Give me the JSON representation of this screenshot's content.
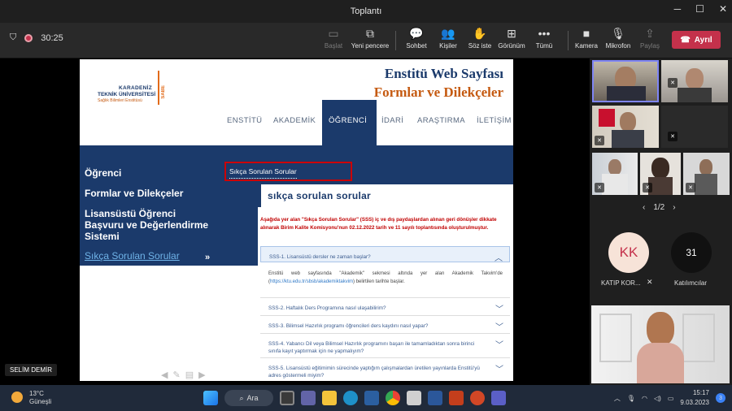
{
  "window": {
    "title": "Toplantı"
  },
  "toolbar": {
    "timer": "30:25",
    "buttons": [
      {
        "label": "Başlat",
        "icon": "start-icon"
      },
      {
        "label": "Yeni pencere",
        "icon": "popout-icon"
      },
      {
        "label": "Sohbet",
        "icon": "chat-icon"
      },
      {
        "label": "Kişiler",
        "icon": "people-icon"
      },
      {
        "label": "Söz iste",
        "icon": "raise-hand-icon"
      },
      {
        "label": "Görünüm",
        "icon": "view-icon"
      },
      {
        "label": "Tümü",
        "icon": "more-icon"
      },
      {
        "label": "Kamera",
        "icon": "camera-icon"
      },
      {
        "label": "Mikrofon",
        "icon": "mic-off-icon"
      },
      {
        "label": "Paylaş",
        "icon": "share-icon"
      }
    ],
    "leave_label": "Ayrıl"
  },
  "slide": {
    "logo": {
      "line1": "KARADENİZ",
      "line2": "TEKNİK ÜNİVERSİTESİ",
      "line3": "Sağlık Bilimleri Enstitüsü",
      "badge": "SABE"
    },
    "title1": "Enstitü Web Sayfası",
    "title2": "Formlar ve Dilekçeler",
    "nav": [
      "ENSTİTÜ",
      "AKADEMİK",
      "ÖĞRENCİ",
      "İDARİ",
      "ARAŞTIRMA",
      "İLETİŞİM"
    ],
    "sidemenu": [
      "Öğrenci",
      "Formlar ve Dilekçeler",
      "Lisansüstü Öğrenci",
      "Başvuru ve Değerlendirme",
      "Sistemi",
      "Sıkça Sorulan Sorular"
    ],
    "search_label": "Sıkça Sorulan Sorular",
    "panel_title": "sıkça sorulan sorular",
    "intro": "Aşağıda yer alan \"Sıkça Sorulan Sorular\" (SSS) iç ve dış paydaşlardan alınan geri dönüşler dikkate alınarak Birim Kalite Komisyonu'nun 02.12.2022 tarih ve 11 sayılı toplantısında oluşturulmuştur.",
    "faqs": [
      "SSS-1. Lisansüstü dersler ne zaman başlar?",
      "SSS-2. Haftalık Ders Programına nasıl ulaşabilirim?",
      "SSS-3. Bilimsel Hazırlık programı öğrencileri ders kaydını nasıl yapar?",
      "SSS-4. Yabancı Dil veya Bilimsel Hazırlık programını başarı ile tamamladıktan sonra birinci sınıfa kayıt yaptırmak için ne yapmalıyım?",
      "SSS-5. Lisansüstü eğitimimin sürecinde yaptığım çalışmalardan üretilen yayınlarda Enstitü'yü adres göstermeli miyim?"
    ],
    "answer_pre": "Enstitü web sayfasında \"Akademik\" sekmesi altında yer alan Akademik Takvim'de (",
    "answer_link": "https://ktu.edu.tr/sbsb/akademiktakvim",
    "answer_post": ") belirtilen tarihte başlar."
  },
  "presenter_name": "SELİM DEMİR",
  "participants": {
    "pager": "1/2",
    "avatar_initials": "KK",
    "avatar_name": "KATIP KOR...",
    "count": "31",
    "count_label": "Katılımcılar"
  },
  "taskbar": {
    "temp": "13°C",
    "weather": "Güneşli",
    "search": "Ara",
    "time": "15:17",
    "date": "9.03.2023",
    "notif": "3"
  }
}
